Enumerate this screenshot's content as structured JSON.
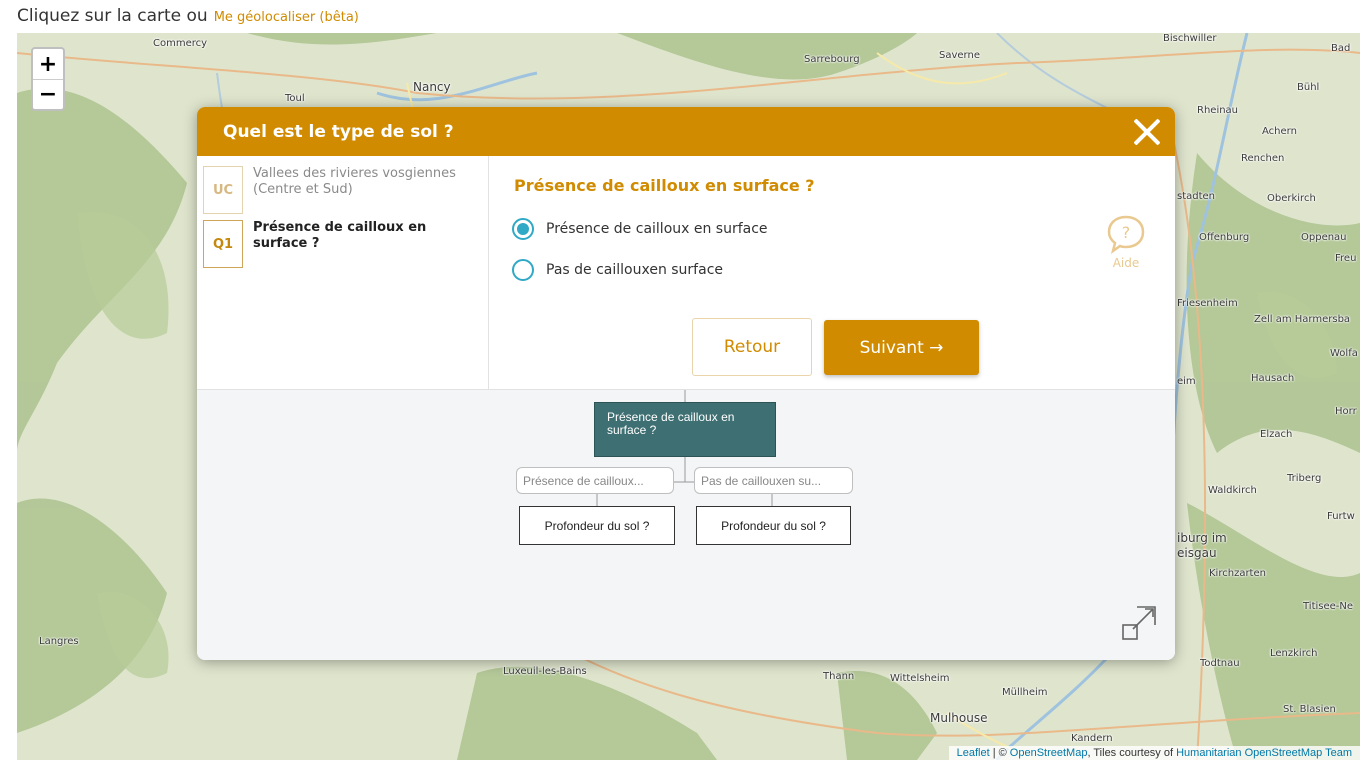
{
  "header": {
    "lead_text": "Cliquez sur la carte ou",
    "geolocate_link": "Me géolocaliser (bêta)"
  },
  "map": {
    "zoom_in": "+",
    "zoom_out": "−",
    "places": {
      "commercy": "Commercy",
      "nancy": "Nancy",
      "toul": "Toul",
      "sarrebourg": "Sarrebourg",
      "saverne": "Saverne",
      "bischwiller": "Bischwiller",
      "bad": "Bad",
      "buhl": "Bühl",
      "rheinau": "Rheinau",
      "achern": "Achern",
      "renchen": "Renchen",
      "stadten": "stadten",
      "oberkirch": "Oberkirch",
      "offenburg": "Offenburg",
      "oppenau": "Oppenau",
      "freu": "Freu",
      "friesenheim": "Friesenheim",
      "zell": "Zell am Harmersba",
      "wolfa": "Wolfa",
      "eim": "eim",
      "hausach": "Hausach",
      "horr": "Horr",
      "elzach": "Elzach",
      "waldkirch": "Waldkirch",
      "triberg": "Triberg",
      "furtw": "Furtw",
      "freiburg1": "iburg im",
      "freiburg2": "eisgau",
      "kirchzarten": "Kirchzarten",
      "titisee": "Titisee-Ne",
      "langres": "Langres",
      "todtnau": "Todtnau",
      "lenzkirch": "Lenzkirch",
      "luxeuil": "Luxeuil-les-Bains",
      "thann": "Thann",
      "wittelsheim": "Wittelsheim",
      "mullheim": "Müllheim",
      "mulhouse": "Mulhouse",
      "stblasien": "St. Blasien",
      "kandern": "Kandern"
    },
    "attribution": {
      "leaflet": "Leaflet",
      "sep": "| ©",
      "osm": "OpenStreetMap",
      "tiles": ", Tiles courtesy of",
      "hot": "Humanitarian OpenStreetMap Team"
    }
  },
  "modal": {
    "title": "Quel est le type de sol ?",
    "steps": [
      {
        "code": "UC",
        "label": "Vallees des rivieres vosgiennes (Centre et Sud)",
        "active": false
      },
      {
        "code": "Q1",
        "label": "Présence de cailloux en surface ?",
        "active": true
      }
    ],
    "question": "Présence de cailloux en surface ?",
    "options": [
      {
        "label": "Présence de cailloux en surface",
        "selected": true
      },
      {
        "label": "Pas de caillouxen surface",
        "selected": false
      }
    ],
    "help_label": "Aide",
    "back_label": "Retour",
    "next_label": "Suivant →",
    "tree": {
      "current": "Présence de cailloux en surface ?",
      "option_left": "Présence de cailloux...",
      "option_right": "Pas de caillouxen su...",
      "child_left": "Profondeur du sol ?",
      "child_right": "Profondeur du sol ?"
    }
  },
  "colors": {
    "accent": "#d08b00",
    "radio": "#2fa9c6",
    "tree_node": "#3e6f72",
    "link": "#0078a8"
  }
}
